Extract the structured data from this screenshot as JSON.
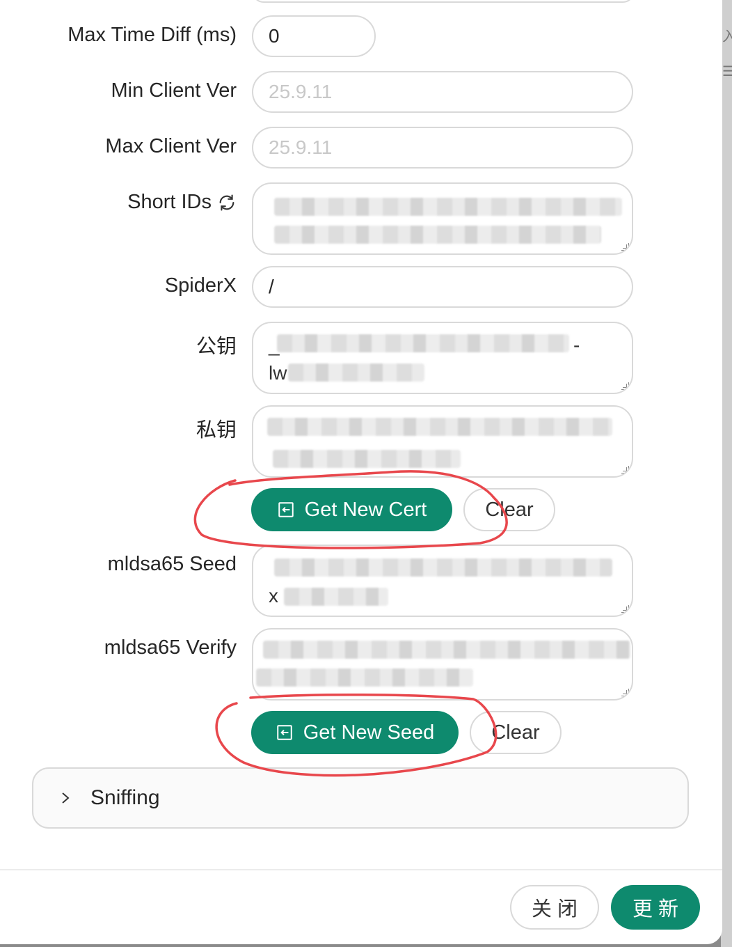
{
  "form": {
    "max_time_diff": {
      "label": "Max Time Diff (ms)",
      "value": "0"
    },
    "min_client_ver": {
      "label": "Min Client Ver",
      "placeholder": "25.9.11"
    },
    "max_client_ver": {
      "label": "Max Client Ver",
      "placeholder": "25.9.11"
    },
    "short_ids": {
      "label": "Short IDs"
    },
    "spiderx": {
      "label": "SpiderX",
      "value": "/"
    },
    "public_key": {
      "label": "公钥",
      "visible_prefix_line1": "_",
      "visible_prefix_line2": "lw",
      "visible_suffix": "-"
    },
    "private_key": {
      "label": "私钥"
    },
    "cert_buttons": {
      "get_new": "Get New Cert",
      "clear": "Clear"
    },
    "mldsa65_seed": {
      "label": "mldsa65 Seed",
      "visible_prefix": "x"
    },
    "mldsa65_verify": {
      "label": "mldsa65 Verify"
    },
    "seed_buttons": {
      "get_new": "Get New Seed",
      "clear": "Clear"
    },
    "sniffing": {
      "label": "Sniffing"
    }
  },
  "footer": {
    "close": "关 闭",
    "update": "更 新"
  },
  "colors": {
    "primary": "#0e8a6e",
    "annotation": "#e8474c",
    "border": "#d9d9d9"
  },
  "icons": {
    "refresh": "refresh-icon",
    "import": "import-icon",
    "chevron": "chevron-right-icon"
  }
}
